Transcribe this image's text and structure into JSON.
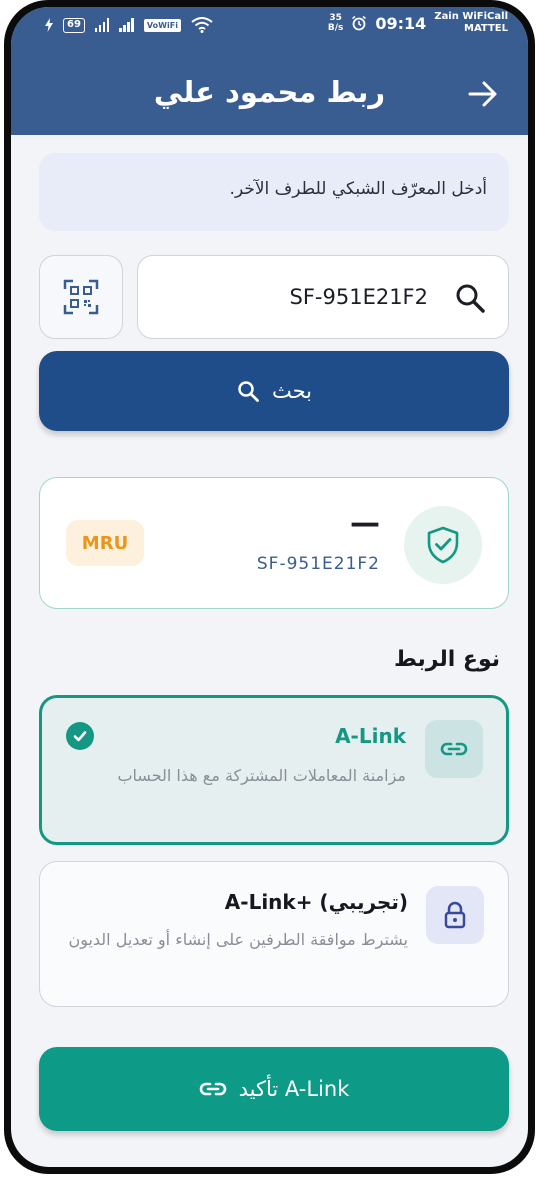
{
  "status_bar": {
    "battery": "69",
    "volte": "VoWiFi",
    "roaming": "R",
    "sim": "1",
    "speed_value": "35",
    "speed_unit": "B/s",
    "time": "09:14",
    "carrier_line1": "Zain WiFiCall",
    "carrier_line2": "MATTEL"
  },
  "header": {
    "title": "ربط محمود علي",
    "back_icon": "arrow-right-icon"
  },
  "info_banner": {
    "text": "أدخل المعرّف الشبكي للطرف الآخر."
  },
  "search": {
    "value": "SF-951E21F2",
    "search_icon": "search-icon",
    "qr_icon": "qr-scan-icon",
    "button_label": "بحث"
  },
  "result": {
    "name": "—",
    "code": "SF-951E21F2",
    "currency": "MRU",
    "verified_icon": "shield-check-icon"
  },
  "link_type": {
    "section_title": "نوع الربط",
    "options": [
      {
        "title": "A-Link",
        "description": "مزامنة المعاملات المشتركة مع هذا الحساب",
        "icon": "link-icon",
        "selected": true
      },
      {
        "title": "A-Link+ (تجريبي)",
        "description": "يشترط موافقة الطرفين على إنشاء أو تعديل الديون",
        "icon": "lock-icon",
        "selected": false
      }
    ]
  },
  "confirm": {
    "label": "تأكيد A-Link",
    "icon": "link-icon"
  },
  "colors": {
    "header_bg": "#3a5d91",
    "primary_button": "#1e4d8a",
    "accent_green": "#149883",
    "confirm_button": "#0d9a86",
    "mru_text": "#e8961c"
  }
}
